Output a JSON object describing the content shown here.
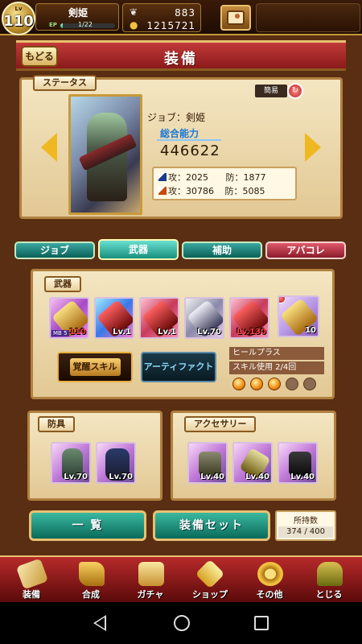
{
  "top_bar": {
    "level_label": "Lv",
    "level": "110",
    "player_name": "剣姫",
    "ep_label": "EP",
    "ep_value": "1/22",
    "ep_fraction": 0.05,
    "feathers": "883",
    "gold": "1215721"
  },
  "header": {
    "back_label": "もどる",
    "title": "装備"
  },
  "status": {
    "section_label": "ステータス",
    "simple_label": "簡易",
    "job_line": "ジョブ：剣姫",
    "total_label": "総合能力",
    "total_value": "446622",
    "stats": [
      {
        "attack": "攻：2025",
        "defense": "防：1877"
      },
      {
        "attack": "攻：30786",
        "defense": "防：5085"
      }
    ]
  },
  "tabs": [
    "ジョブ",
    "武器",
    "補助",
    "アバコレ"
  ],
  "weapons": {
    "section_label": "武器",
    "cards": [
      {
        "level": "110",
        "mb": "MB 5",
        "red": true
      },
      {
        "level": "Lv.1",
        "red": false
      },
      {
        "level": "Lv.1",
        "red": false
      },
      {
        "level": "Lv.70",
        "red": false
      },
      {
        "level": "Lv.130",
        "red": true
      }
    ],
    "sub_slot_level": "10",
    "awaken_label": "覚醒スキル",
    "artifact_label": "アーティファクト",
    "skill_name": "ヒールプラス",
    "skill_uses": "スキル使用 2/4回"
  },
  "armor": {
    "section_label": "防具",
    "cards": [
      {
        "level": "Lv.70"
      },
      {
        "level": "Lv.70"
      }
    ]
  },
  "accessory": {
    "section_label": "アクセサリー",
    "cards": [
      {
        "level": "Lv.40"
      },
      {
        "level": "Lv.40"
      },
      {
        "level": "Lv.40"
      }
    ]
  },
  "actions": {
    "list_label": "一 覧",
    "set_label": "装備セット",
    "capacity_label": "所持数",
    "capacity_value": "374 / 400"
  },
  "nav": {
    "items": [
      "装備",
      "合成",
      "ガチャ",
      "ショップ",
      "その他",
      "とじる"
    ]
  }
}
